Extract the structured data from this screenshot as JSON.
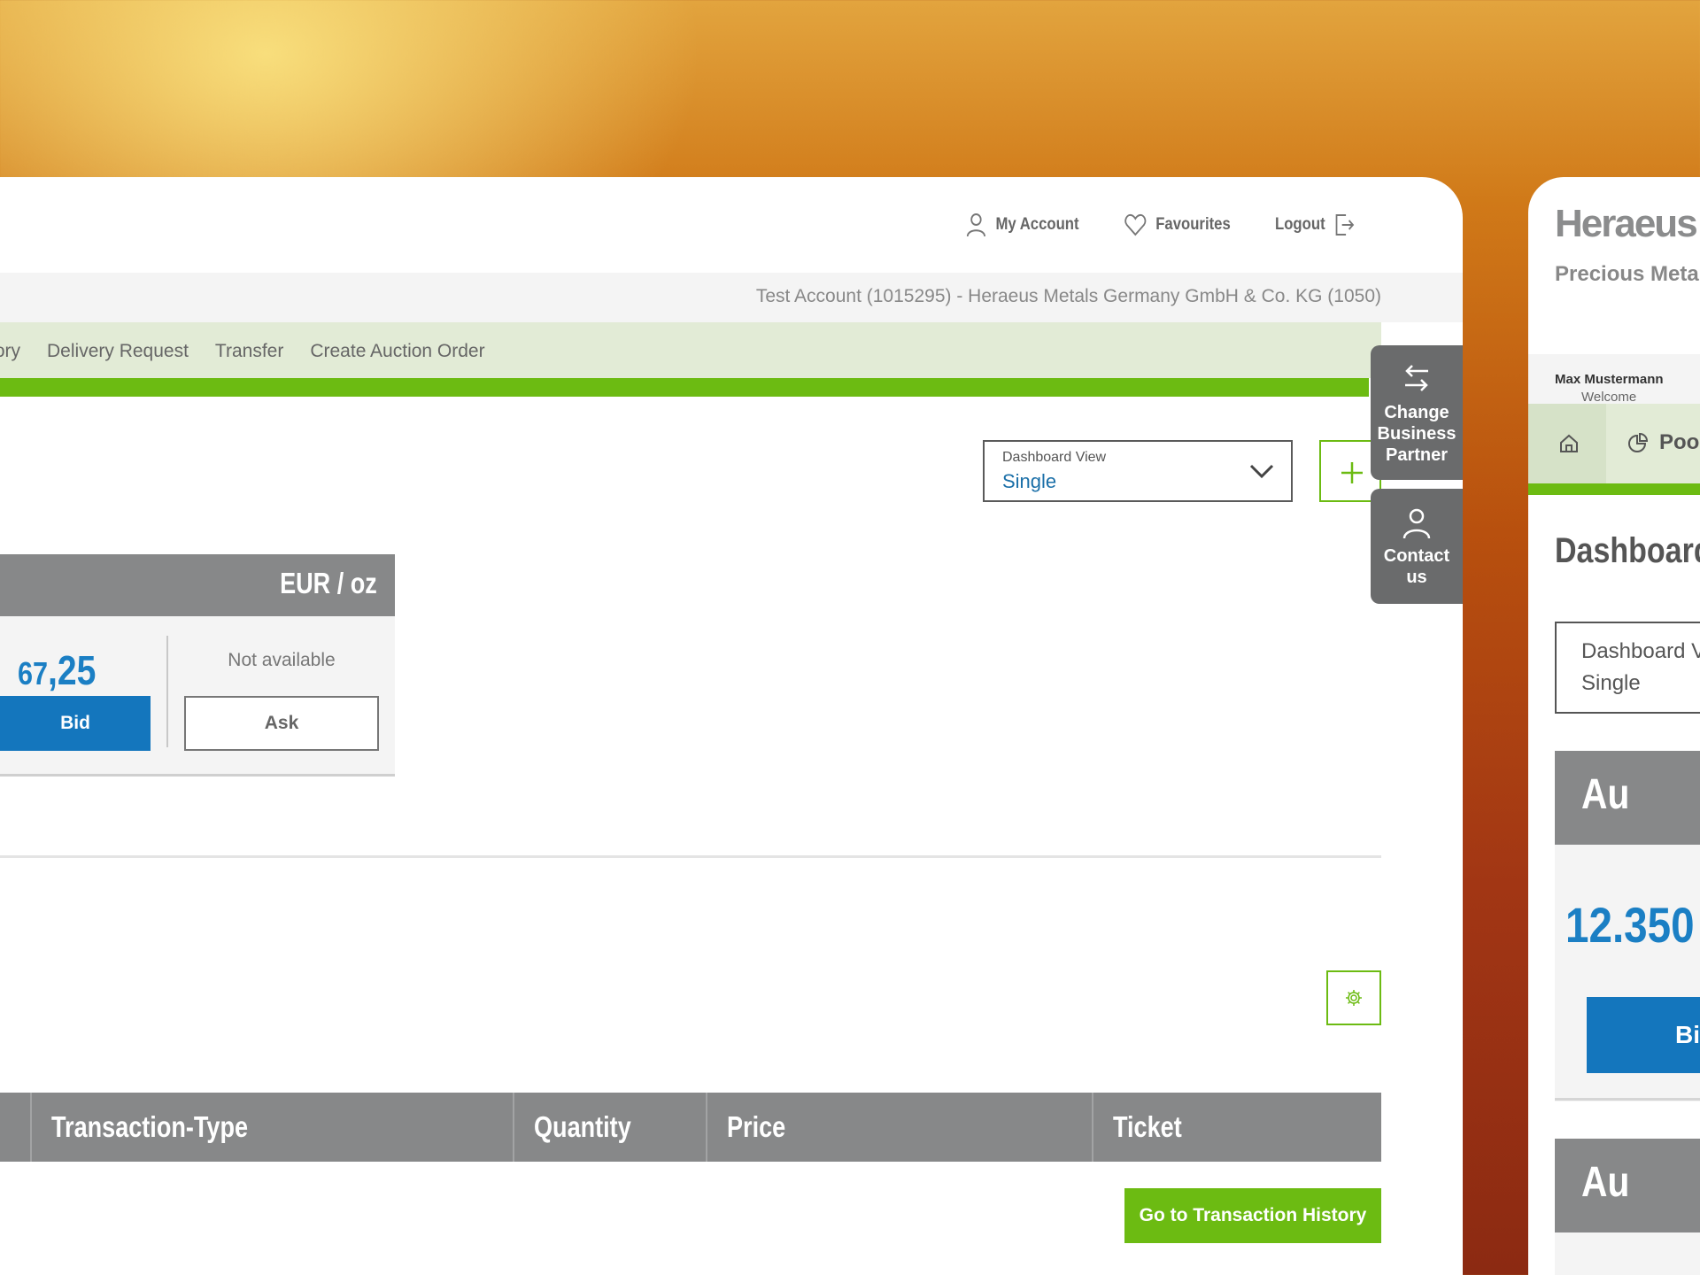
{
  "header": {
    "my_account": "My Account",
    "favourites": "Favourites",
    "logout": "Logout"
  },
  "account_bar": {
    "text": "Test Account (1015295) - Heraeus Metals Germany GmbH & Co. KG (1050)"
  },
  "menu": {
    "items": [
      "tory",
      "Delivery Request",
      "Transfer",
      "Create Auction Order"
    ]
  },
  "dashboard_view": {
    "label": "Dashboard View",
    "value": "Single"
  },
  "price_card": {
    "currency_unit": "EUR / oz",
    "bid_price_main": "67",
    "bid_price_decimals": ",25",
    "ask_status": "Not available",
    "bid_label": "Bid",
    "ask_label": "Ask"
  },
  "side_tabs": {
    "change_partner": [
      "Change",
      "Business",
      "Partner"
    ],
    "contact": [
      "Contact",
      "us"
    ]
  },
  "table": {
    "columns": [
      "Transaction-Type",
      "Quantity",
      "Price",
      "Ticket"
    ]
  },
  "history_button": "Go to Transaction History",
  "mobile": {
    "logo": "Heraeus",
    "subtitle": "Precious Metals",
    "welcome_prefix": "Welcome",
    "welcome_name": "Max Mustermann",
    "nav_pool": "Pool",
    "title": "Dashboard",
    "select_label": "Dashboard View",
    "select_value": "Single",
    "card1_metal": "Au",
    "card1_price": "12.350",
    "card1_bid": "Bid",
    "card2_metal": "Au"
  },
  "colors": {
    "accent_green": "#6cbb12",
    "primary_blue": "#1476bd",
    "header_grey": "#878889"
  }
}
